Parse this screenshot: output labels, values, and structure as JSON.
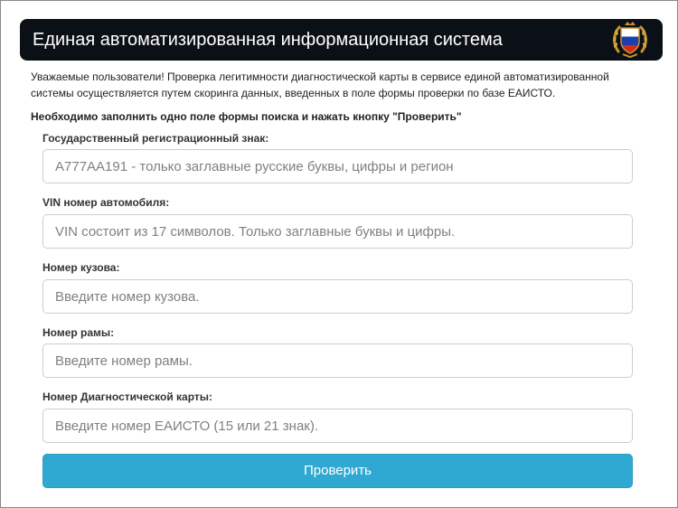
{
  "header": {
    "title": "Единая автоматизированная информационная система",
    "emblem_icon": "russian-flag-emblem-icon",
    "colors": {
      "background": "#0b1016",
      "text": "#ffffff"
    }
  },
  "intro": {
    "text": "Уважаемые пользователи! Проверка легитимности диагностической карты в сервисе единой автоматизированной системы осуществляется путем скоринга данных, введенных в поле формы проверки по базе ЕАИСТО."
  },
  "instruction": {
    "text": "Необходимо заполнить одно поле формы поиска и нажать кнопку \"Проверить\""
  },
  "form": {
    "fields": [
      {
        "label": "Государственный регистрационный знак:",
        "value": "",
        "placeholder": "А777АА191 - только заглавные русские буквы, цифры и регион"
      },
      {
        "label": "VIN номер автомобиля:",
        "value": "",
        "placeholder": "VIN состоит из 17 символов. Только заглавные буквы и цифры."
      },
      {
        "label": "Номер кузова:",
        "value": "",
        "placeholder": "Введите номер кузова."
      },
      {
        "label": "Номер рамы:",
        "value": "",
        "placeholder": "Введите номер рамы."
      },
      {
        "label": "Номер Диагностической карты:",
        "value": "",
        "placeholder": "Введите номер ЕАИСТО (15 или 21 знак)."
      }
    ],
    "submit_label": "Проверить",
    "submit_color": "#2fa9d2"
  }
}
